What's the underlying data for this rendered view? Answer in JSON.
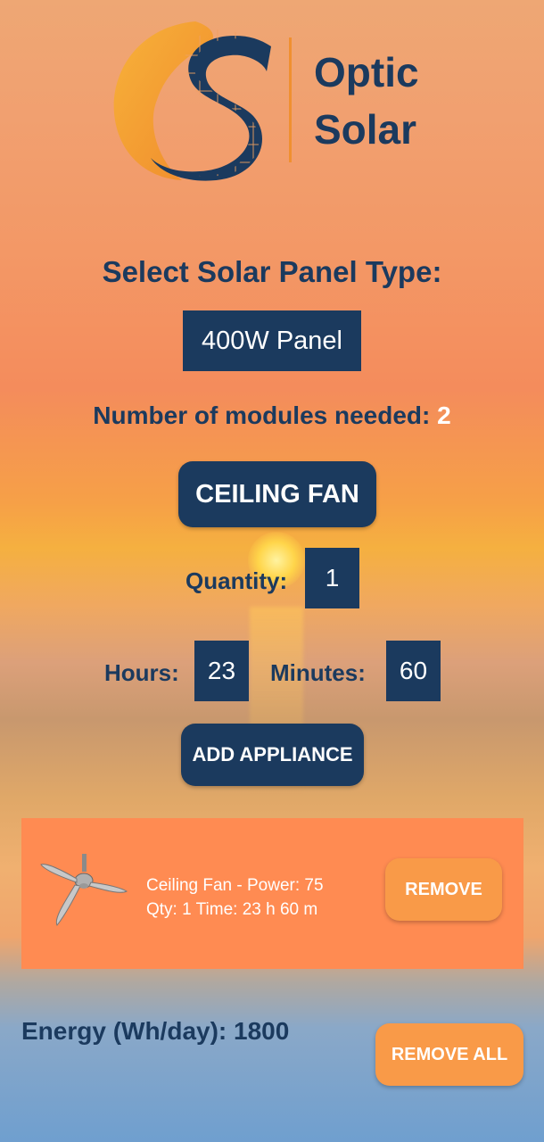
{
  "brand": {
    "line1": "Optic",
    "line2": "Solar"
  },
  "panel": {
    "title": "Select Solar Panel Type:",
    "selected": "400W Panel"
  },
  "modules": {
    "label": "Number of modules needed:",
    "value": "2"
  },
  "appliance": {
    "selected": "CEILING FAN"
  },
  "quantity": {
    "label": "Quantity:",
    "value": "1"
  },
  "time": {
    "hours_label": "Hours:",
    "hours_value": "23",
    "minutes_label": "Minutes:",
    "minutes_value": "60"
  },
  "add_button": "ADD APPLIANCE",
  "appliance_list": [
    {
      "line1": "Ceiling Fan - Power: 75",
      "line2": "Qty: 1 Time: 23 h 60 m",
      "remove_label": "REMOVE"
    }
  ],
  "energy": {
    "label": "Energy (Wh/day):",
    "value": "1800"
  },
  "remove_all_label": "REMOVE ALL",
  "colors": {
    "navy": "#1b3a5e",
    "orange_card": "#ff8b52",
    "orange_button": "#f99a48",
    "accent": "#f09030"
  },
  "icons": {
    "logo": "optic-solar-logo-icon",
    "fan": "ceiling-fan-icon"
  }
}
